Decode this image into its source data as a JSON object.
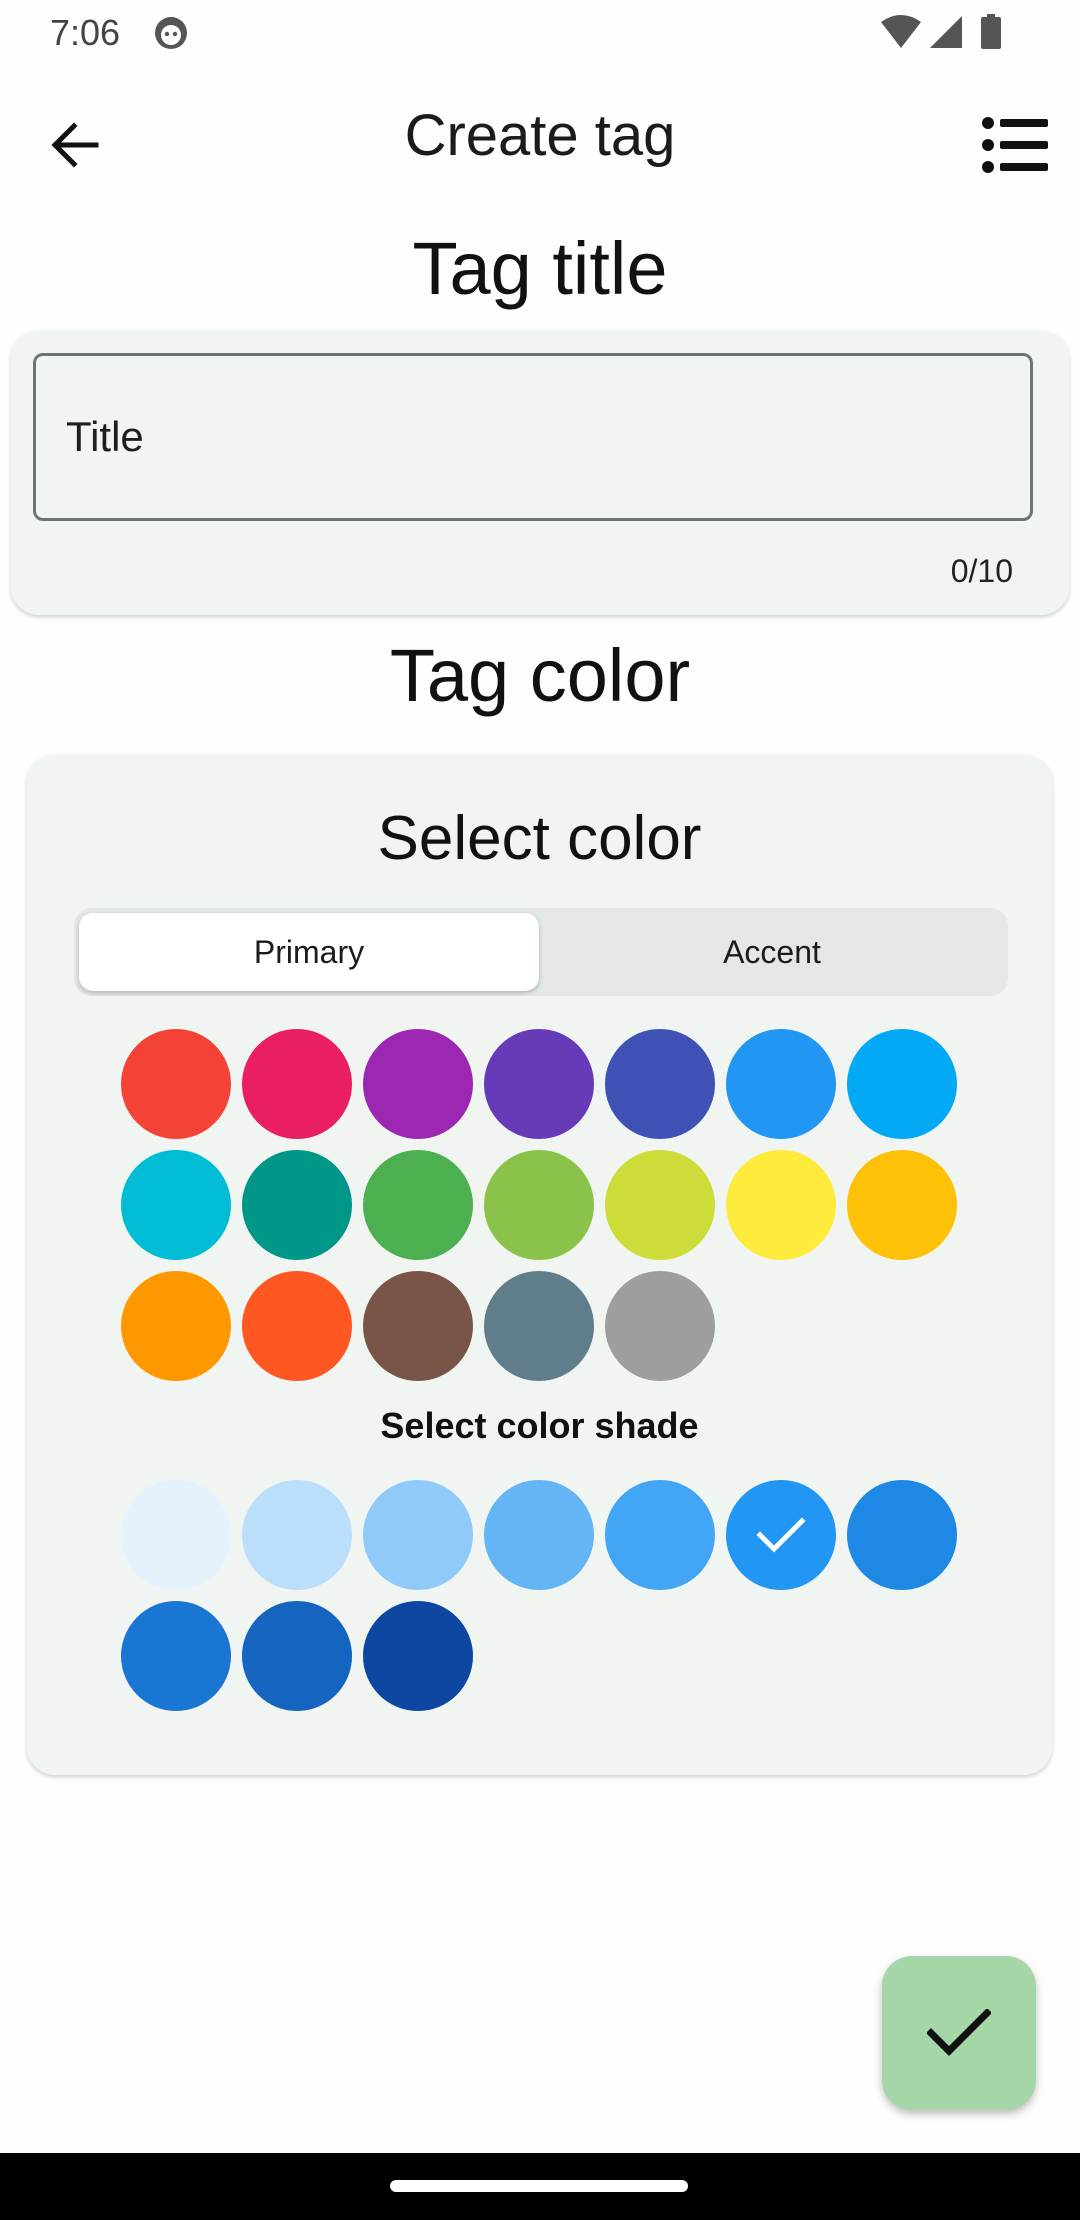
{
  "status_bar": {
    "time": "7:06",
    "icons": [
      "face-icon",
      "wifi-icon",
      "signal-icon",
      "battery-icon"
    ]
  },
  "app_bar": {
    "title": "Create tag",
    "back_icon": "arrow-back-icon",
    "menu_icon": "list-icon"
  },
  "tag_title": {
    "heading": "Tag title",
    "input_placeholder": "Title",
    "input_value": "",
    "counter": "0/10"
  },
  "tag_color": {
    "heading": "Tag color",
    "select_heading": "Select color",
    "tabs": [
      {
        "label": "Primary",
        "selected": true
      },
      {
        "label": "Accent",
        "selected": false
      }
    ],
    "colors": [
      "#F44336",
      "#E91E63",
      "#9C27B0",
      "#673AB7",
      "#3F51B5",
      "#2196F3",
      "#03A9F4",
      "#00BCD4",
      "#009688",
      "#4CAF50",
      "#8BC34A",
      "#CDDC39",
      "#FFEB3B",
      "#FFC107",
      "#FF9800",
      "#FF5722",
      "#795548",
      "#607D8B",
      "#9E9E9E"
    ],
    "shade_heading": "Select color shade",
    "shades": [
      "#E3F2FD",
      "#BBDEFB",
      "#90CAF9",
      "#64B5F6",
      "#42A5F5",
      "#2196F3",
      "#1E88E5",
      "#1976D2",
      "#1565C0",
      "#0D47A1"
    ],
    "selected_shade_index": 5
  },
  "fab": {
    "icon": "check-icon"
  }
}
